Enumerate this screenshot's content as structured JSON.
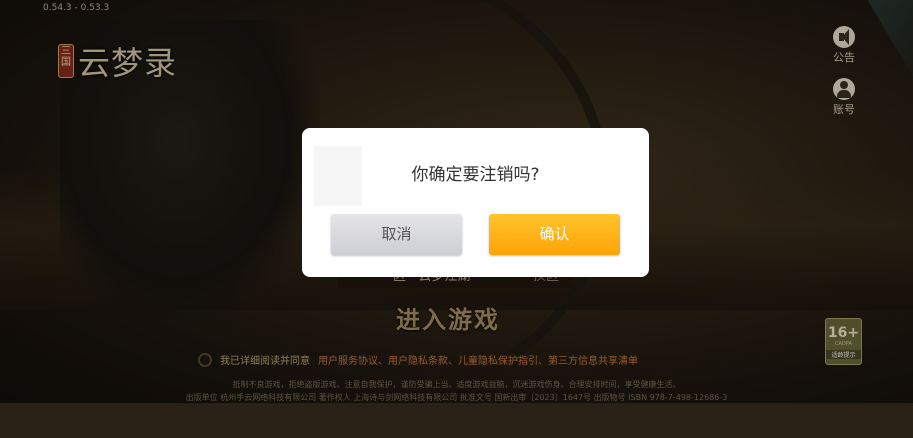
{
  "version": "0.54.3 - 0.53.3",
  "logo": {
    "seal_text": "三国",
    "title": "云梦录"
  },
  "side_buttons": {
    "notice_label": "公告",
    "account_label": "账号"
  },
  "server": {
    "name": "一区 · 云梦江湖",
    "switch_label": "换区"
  },
  "enter_button": "进入游戏",
  "agreement": {
    "prefix": "我已详细阅读并同意",
    "links": "用户服务协议、用户隐私条款、儿童隐私保护指引、第三方信息共享清单"
  },
  "health_notice": "抵制不良游戏，拒绝盗版游戏。注意自我保护，谨防受骗上当。适度游戏益脑，沉迷游戏伤身。合理安排时间，享受健康生活。",
  "publisher_line": "出版单位 杭州手云网络科技有限公司  著作权人 上海诗与剑网络科技有限公司  批准文号 国新出审〔2023〕1647号  出版物号 ISBN 978-7-498-12686-3",
  "age_rating": {
    "number": "16+",
    "org": "CADPA",
    "tip": "适龄提示"
  },
  "dialog": {
    "title": "你确定要注销吗?",
    "cancel_label": "取消",
    "confirm_label": "确认"
  },
  "colors": {
    "confirm_button": "#ffa307",
    "cancel_button": "#d9d9dc"
  }
}
